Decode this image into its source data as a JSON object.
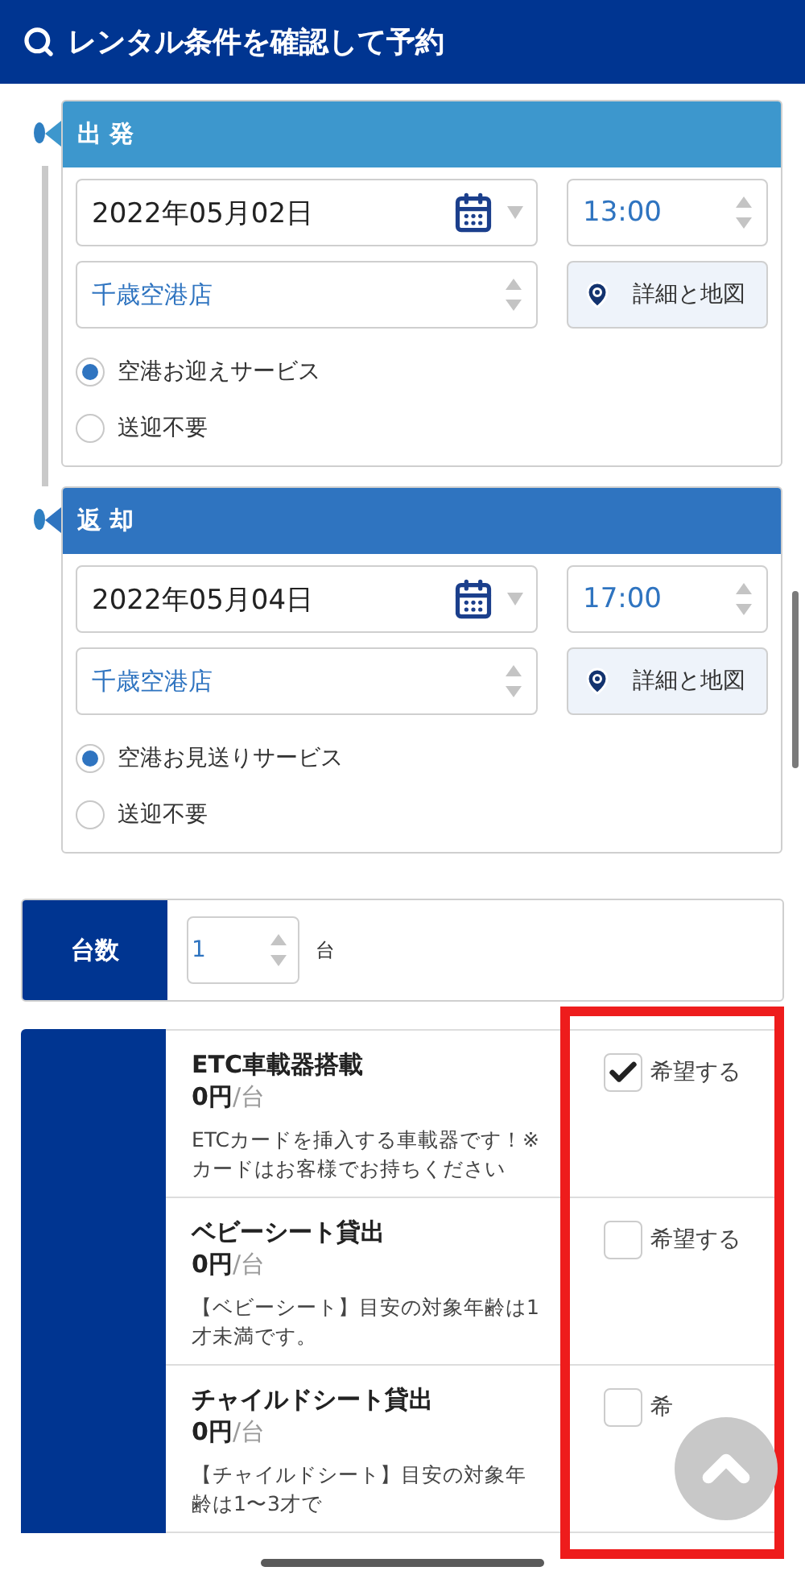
{
  "header": {
    "title": "レンタル条件を確認して予約"
  },
  "legs": [
    {
      "kind": "departure",
      "title": "出 発",
      "date": "2022年05月02日",
      "time": "13:00",
      "store": "千歳空港店",
      "map_button": "詳細と地図",
      "options": [
        {
          "label": "空港お迎えサービス",
          "selected": true
        },
        {
          "label": "送迎不要",
          "selected": false
        }
      ]
    },
    {
      "kind": "return",
      "title": "返 却",
      "date": "2022年05月04日",
      "time": "17:00",
      "store": "千歳空港店",
      "map_button": "詳細と地図",
      "options": [
        {
          "label": "空港お見送りサービス",
          "selected": true
        },
        {
          "label": "送迎不要",
          "selected": false
        }
      ]
    }
  ],
  "count": {
    "label": "台数",
    "value": "1",
    "unit": "台"
  },
  "extras": [
    {
      "name": "ETC車載器搭載",
      "price": "0円",
      "per": "/台",
      "checked": true,
      "check_label": "希望する",
      "description": "ETCカードを挿入する車載器です！※カードはお客様でお持ちください"
    },
    {
      "name": "ベビーシート貸出",
      "price": "0円",
      "per": "/台",
      "checked": false,
      "check_label": "希望する",
      "description": "【ベビーシート】目安の対象年齢は1才未満です。"
    },
    {
      "name": "チャイルドシート貸出",
      "price": "0円",
      "per": "/台",
      "checked": false,
      "check_label": "希",
      "description": "【チャイルドシート】目安の対象年齢は1〜3才で"
    }
  ]
}
